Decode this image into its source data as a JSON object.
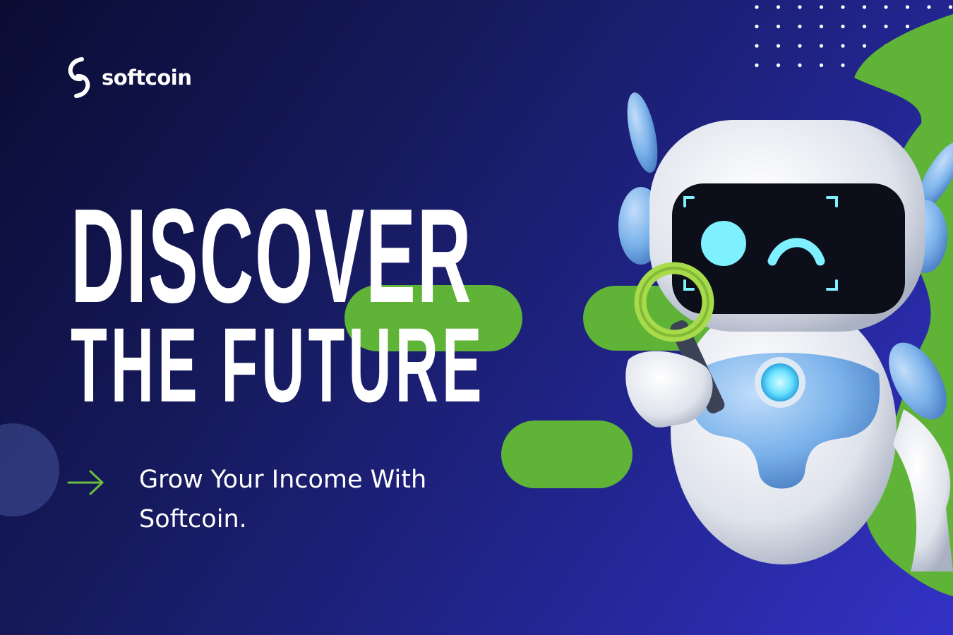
{
  "brand": {
    "name": "softcoin",
    "logo_icon": "s-swirl-logo-icon"
  },
  "headline": {
    "line1": "DISCOVER",
    "line2": "THE FUTURE"
  },
  "tagline": {
    "text": "Grow Your Income With Softcoin.",
    "icon": "arrow-right-icon"
  },
  "illustration": {
    "subject": "robot-with-magnifying-glass"
  },
  "colors": {
    "background_dark": "#0a0c33",
    "background_light": "#3332c6",
    "accent_green": "#5fb336",
    "robot_blue": "#7ab2ea",
    "robot_eye": "#7ef0ff",
    "text": "#ffffff"
  }
}
